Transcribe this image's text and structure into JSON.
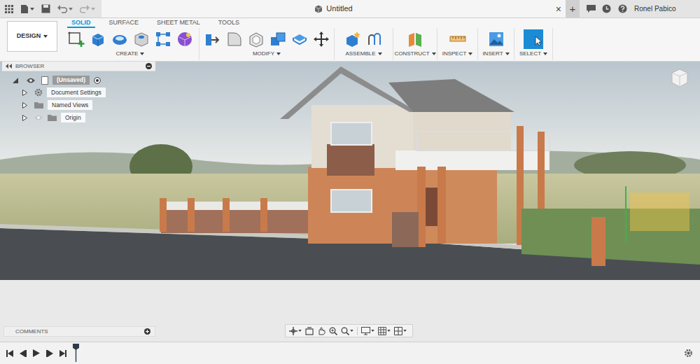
{
  "window": {
    "title": "Untitled",
    "close": "×",
    "new_tab": "+",
    "user": "Ronel Pabico"
  },
  "workspace": {
    "label": "DESIGN"
  },
  "tabs": [
    {
      "label": "SOLID",
      "selected": true
    },
    {
      "label": "SURFACE",
      "selected": false
    },
    {
      "label": "SHEET METAL",
      "selected": false
    },
    {
      "label": "TOOLS",
      "selected": false
    }
  ],
  "groups": [
    {
      "label": "CREATE"
    },
    {
      "label": "MODIFY"
    },
    {
      "label": "ASSEMBLE"
    },
    {
      "label": "CONSTRUCT"
    },
    {
      "label": "INSPECT"
    },
    {
      "label": "INSERT"
    },
    {
      "label": "SELECT"
    }
  ],
  "browser": {
    "title": "BROWSER",
    "root": {
      "label": "(Unsaved)",
      "expanded": true
    },
    "items": [
      {
        "label": "Document Settings",
        "expanded": false,
        "kind": "settings"
      },
      {
        "label": "Named Views",
        "expanded": false,
        "kind": "folder"
      },
      {
        "label": "Origin",
        "expanded": false,
        "kind": "hidden-folder"
      }
    ]
  },
  "comments": {
    "title": "COMMENTS"
  }
}
